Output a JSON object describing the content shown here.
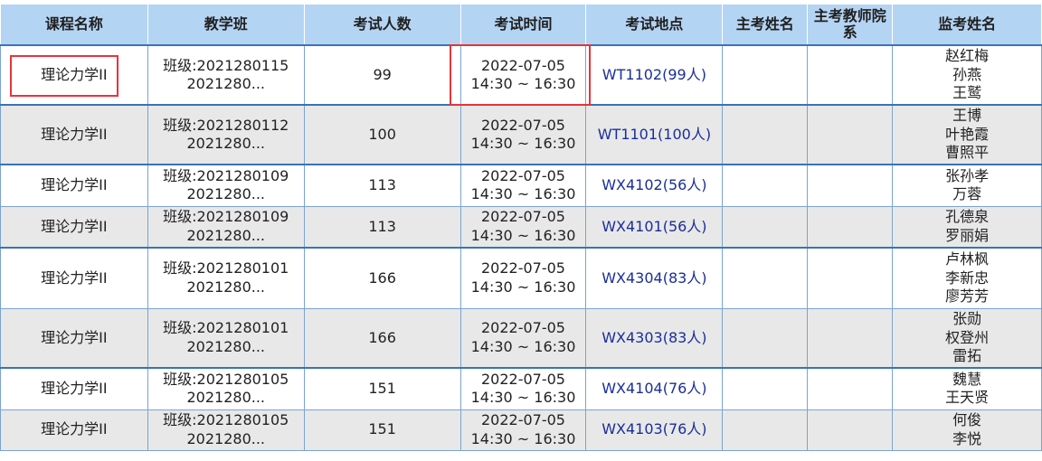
{
  "headers": [
    "课程名称",
    "教学班",
    "考试人数",
    "考试时间",
    "考试地点",
    "主考姓名",
    "主考教师院系",
    "监考姓名"
  ],
  "rows": [
    {
      "course": "理论力学II",
      "class_line1": "班级:2021280115",
      "class_line2": "2021280...",
      "count": "99",
      "date": "2022-07-05",
      "time": "14:30 ~ 16:30",
      "location": "WT1102(99人)",
      "chief": "",
      "dept": "",
      "invigilators": [
        "赵红梅",
        "孙燕",
        "王鹫"
      ]
    },
    {
      "course": "理论力学II",
      "class_line1": "班级:2021280112",
      "class_line2": "2021280...",
      "count": "100",
      "date": "2022-07-05",
      "time": "14:30 ~ 16:30",
      "location": "WT1101(100人)",
      "chief": "",
      "dept": "",
      "invigilators": [
        "王博",
        "叶艳霞",
        "曹照平"
      ]
    },
    {
      "course": "理论力学II",
      "class_line1": "班级:2021280109",
      "class_line2": "2021280...",
      "count": "113",
      "date": "2022-07-05",
      "time": "14:30 ~ 16:30",
      "location": "WX4102(56人)",
      "chief": "",
      "dept": "",
      "invigilators": [
        "张孙孝",
        "万蓉"
      ]
    },
    {
      "course": "理论力学II",
      "class_line1": "班级:2021280109",
      "class_line2": "2021280...",
      "count": "113",
      "date": "2022-07-05",
      "time": "14:30 ~ 16:30",
      "location": "WX4101(56人)",
      "chief": "",
      "dept": "",
      "invigilators": [
        "孔德泉",
        "罗丽娟"
      ]
    },
    {
      "course": "理论力学II",
      "class_line1": "班级:2021280101",
      "class_line2": "2021280...",
      "count": "166",
      "date": "2022-07-05",
      "time": "14:30 ~ 16:30",
      "location": "WX4304(83人)",
      "chief": "",
      "dept": "",
      "invigilators": [
        "卢林枫",
        "李新忠",
        "廖芳芳"
      ]
    },
    {
      "course": "理论力学II",
      "class_line1": "班级:2021280101",
      "class_line2": "2021280...",
      "count": "166",
      "date": "2022-07-05",
      "time": "14:30 ~ 16:30",
      "location": "WX4303(83人)",
      "chief": "",
      "dept": "",
      "invigilators": [
        "张勋",
        "权登州",
        "雷拓"
      ]
    },
    {
      "course": "理论力学II",
      "class_line1": "班级:2021280105",
      "class_line2": "2021280...",
      "count": "151",
      "date": "2022-07-05",
      "time": "14:30 ~ 16:30",
      "location": "WX4104(76人)",
      "chief": "",
      "dept": "",
      "invigilators": [
        "魏慧",
        "王天贤"
      ]
    },
    {
      "course": "理论力学II",
      "class_line1": "班级:2021280105",
      "class_line2": "2021280...",
      "count": "151",
      "date": "2022-07-05",
      "time": "14:30 ~ 16:30",
      "location": "WX4103(76人)",
      "chief": "",
      "dept": "",
      "invigilators": [
        "何俊",
        "李悦"
      ]
    }
  ],
  "colors": {
    "header_bg": "#b4d4f3",
    "even_row_bg": "#e8e8e8",
    "row_border": "#3a73b6",
    "location_text": "#1a2e9a",
    "highlight": "#e8343a"
  }
}
